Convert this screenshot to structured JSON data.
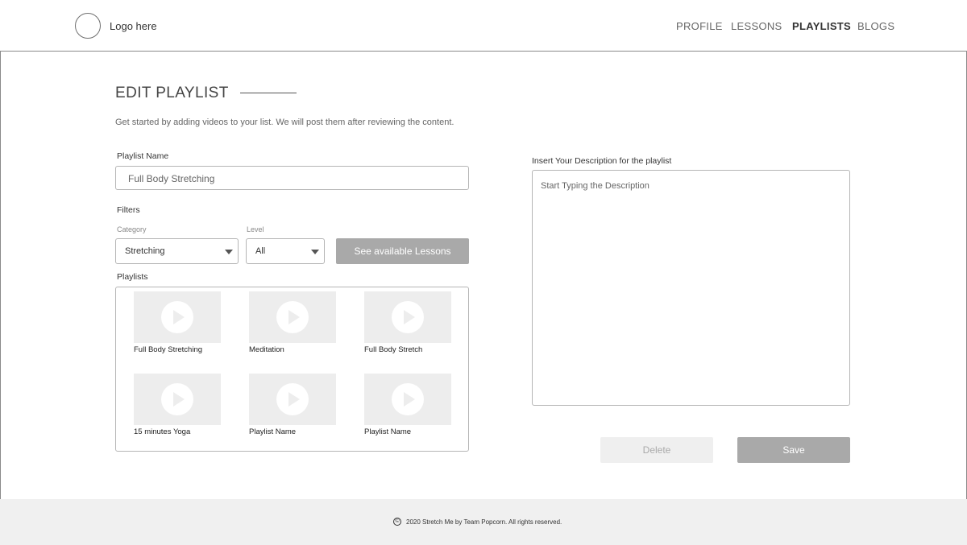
{
  "header": {
    "logo_text": "Logo here",
    "nav": [
      {
        "label": "PROFILE",
        "active": false
      },
      {
        "label": "LESSONS",
        "active": false
      },
      {
        "label": "PLAYLISTS",
        "active": true
      },
      {
        "label": "BLOGS",
        "active": false
      }
    ]
  },
  "main": {
    "title": "EDIT PLAYLIST",
    "subtitle": "Get started by adding videos to your list. We will post them after reviewing the content.",
    "playlist_name_label": "Playlist Name",
    "playlist_name_value": "Full Body Stretching",
    "filters_label": "Filters",
    "category_label": "Category",
    "category_value": "Stretching",
    "level_label": "Level",
    "level_value": "All",
    "see_lessons_button": "See available Lessons",
    "playlists_label": "Playlists",
    "playlists": [
      {
        "name": "Full Body Stretching"
      },
      {
        "name": "Meditation"
      },
      {
        "name": "Full Body Stretch"
      },
      {
        "name": "15 minutes Yoga"
      },
      {
        "name": "Playlist Name"
      },
      {
        "name": "Playlist Name"
      }
    ],
    "description_label": "Insert Your Description for the playlist",
    "description_placeholder": "Start Typing the Description",
    "delete_button": "Delete",
    "save_button": "Save"
  },
  "footer": {
    "copyright_icon": "©",
    "text": "2020 Stretch Me by Team Popcorn. All rights reserved."
  },
  "colors": {
    "primary_button": "#a9a9a9",
    "disabled_button": "#efefef",
    "footer_bg": "#f0f0f0",
    "thumb_bg": "#ededed"
  }
}
